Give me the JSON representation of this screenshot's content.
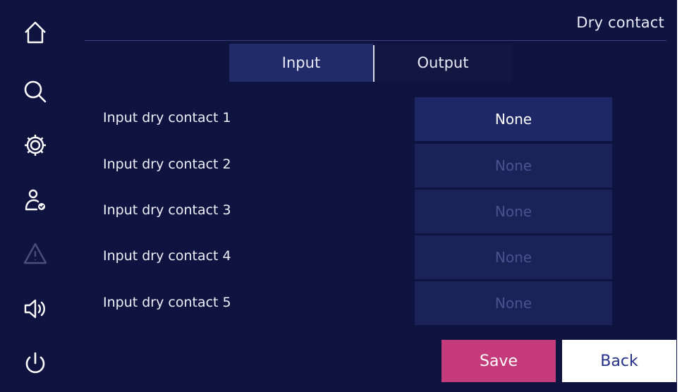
{
  "header": {
    "title": "Dry contact"
  },
  "sidebar": {
    "items": [
      {
        "name": "home-icon"
      },
      {
        "name": "search-icon"
      },
      {
        "name": "settings-gear-icon"
      },
      {
        "name": "user-settings-icon"
      },
      {
        "name": "warning-icon",
        "disabled": true
      },
      {
        "name": "speaker-icon"
      },
      {
        "name": "power-icon"
      }
    ]
  },
  "tabs": [
    {
      "label": "Input",
      "active": true
    },
    {
      "label": "Output",
      "active": false
    }
  ],
  "rows": [
    {
      "label": "Input dry contact 1",
      "value": "None",
      "enabled": true
    },
    {
      "label": "Input dry contact 2",
      "value": "None",
      "enabled": false
    },
    {
      "label": "Input dry contact 3",
      "value": "None",
      "enabled": false
    },
    {
      "label": "Input dry contact 4",
      "value": "None",
      "enabled": false
    },
    {
      "label": "Input dry contact 5",
      "value": "None",
      "enabled": false
    }
  ],
  "buttons": {
    "save": "Save",
    "back": "Back"
  },
  "colors": {
    "background": "#0f1340",
    "accent_save": "#c53a7a",
    "back_button": "#ffffff"
  }
}
